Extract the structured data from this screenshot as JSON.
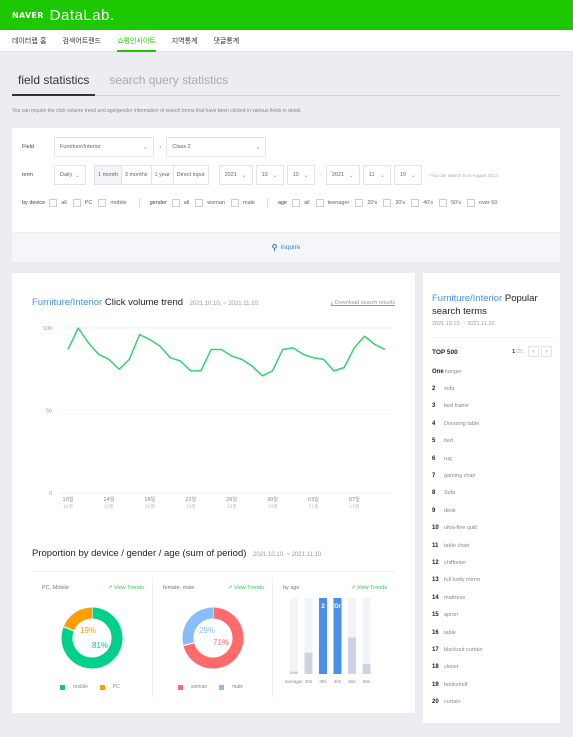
{
  "header": {
    "brand": "NAVER",
    "product": "DataLab."
  },
  "nav": {
    "items": [
      {
        "label": "데이터랩 홈",
        "active": false
      },
      {
        "label": "검색어트렌드",
        "active": false
      },
      {
        "label": "쇼핑인사이트",
        "active": true
      },
      {
        "label": "지역통계",
        "active": false
      },
      {
        "label": "댓글통계",
        "active": false
      }
    ]
  },
  "tabs": [
    {
      "label": "field statistics",
      "active": true
    },
    {
      "label": "search query statistics",
      "active": false
    }
  ],
  "description": "You can inquire the click volume trend and age/gender information of search terms that have been clicked in various fields in detail.",
  "filter": {
    "field_label": "Field",
    "field_select": "Furniture/Interior",
    "class_select": "Class 2",
    "term_label": "term",
    "interval_select": "Daily",
    "periods": [
      "1 month",
      "3 months",
      "1 year",
      "Direct input"
    ],
    "period_selected": "1 month",
    "start": {
      "year": "2021",
      "month": "10",
      "day": "10"
    },
    "end": {
      "year": "2021",
      "month": "11",
      "day": "10"
    },
    "range_sep": "~",
    "hint": "- You can search from August 2017.",
    "device_label": "by device",
    "device_options": [
      "all",
      "PC",
      "mobile"
    ],
    "gender_label": "gender",
    "gender_options": [
      "all",
      "woman",
      "male"
    ],
    "age_label": "age",
    "age_options": [
      "all",
      "teenager",
      "20's",
      "30's",
      "40's",
      "50's",
      "over 60"
    ],
    "inquire_label": "Inquire"
  },
  "trend": {
    "category": "Furniture/Interior",
    "title": "Click volume trend",
    "date_range": "2021.10.10. ~ 2021.11.10.",
    "download_label": "Download search results"
  },
  "chart_data": [
    {
      "type": "line",
      "title": "Furniture/Interior Click volume trend",
      "color": "#33d36b",
      "ylim": [
        0,
        100
      ],
      "yticks": [
        0,
        50,
        100
      ],
      "grid": true,
      "x": [
        "10/10",
        "10/11",
        "10/12",
        "10/13",
        "10/14",
        "10/15",
        "10/16",
        "10/17",
        "10/18",
        "10/19",
        "10/20",
        "10/21",
        "10/22",
        "10/23",
        "10/24",
        "10/25",
        "10/26",
        "10/27",
        "10/28",
        "10/29",
        "10/30",
        "10/31",
        "11/01",
        "11/02",
        "11/03",
        "11/04",
        "11/05",
        "11/06",
        "11/07",
        "11/08",
        "11/09",
        "11/10"
      ],
      "values": [
        87,
        100,
        91,
        84,
        81,
        75,
        81,
        96,
        93,
        89,
        82,
        80,
        74,
        74,
        87,
        87,
        83,
        81,
        77,
        71,
        74,
        87,
        88,
        84,
        82,
        81,
        74,
        76,
        88,
        95,
        90,
        87
      ],
      "xtick_labels": [
        {
          "day": "10일",
          "month": "10월"
        },
        {
          "day": "14일",
          "month": "10월"
        },
        {
          "day": "18일",
          "month": "10월"
        },
        {
          "day": "22일",
          "month": "10월"
        },
        {
          "day": "26일",
          "month": "10월"
        },
        {
          "day": "30일",
          "month": "10월"
        },
        {
          "day": "03일",
          "month": "11월"
        },
        {
          "day": "07일",
          "month": "11월"
        }
      ]
    },
    {
      "type": "pie",
      "title": "PC, Mobile",
      "slices": [
        {
          "label": "mobile",
          "value": 81,
          "color": "#00d08a"
        },
        {
          "label": "PC",
          "value": 19,
          "color": "#ff9e00"
        }
      ]
    },
    {
      "type": "pie",
      "title": "female, male",
      "slices": [
        {
          "label": "woman",
          "value": 71,
          "color": "#ff6b6b"
        },
        {
          "label": "male",
          "value": 29,
          "color": "#86bdfa"
        }
      ]
    },
    {
      "type": "bar",
      "title": "by age",
      "categories": [
        "teenager",
        "20's",
        "30's",
        "40's",
        "50's",
        "60's"
      ],
      "tick_labels": [
        "teenager",
        "20s",
        "30s",
        "40s",
        "50s",
        "60s"
      ],
      "values": [
        3,
        28,
        100,
        100,
        48,
        13
      ],
      "highlight": [
        false,
        false,
        true,
        true,
        false,
        false
      ],
      "value_labels": [
        "",
        "",
        "2",
        "Or",
        "",
        ""
      ],
      "ylim": [
        0,
        100
      ]
    }
  ],
  "proportion": {
    "title": "Proportion by device / gender / age (sum of period)",
    "date_range": "2021.10.10. ~ 2021.11.10.",
    "view_trends_label": "View Trends",
    "panels": [
      {
        "title": "PC, Mobile",
        "pct_a": "19%",
        "pct_b": "81%",
        "legend": [
          "mobile",
          "PC"
        ]
      },
      {
        "title": "female, male",
        "pct_a": "29%",
        "pct_b": "71%",
        "legend": [
          "woman",
          "male"
        ]
      },
      {
        "title": "by age"
      }
    ]
  },
  "popular": {
    "category": "Furniture/Interior",
    "title": "Popular search terms",
    "date_range": "2021.10.10. ~ 2021.11.10.",
    "top_label": "TOP 500",
    "page_current": "1",
    "page_total": "/25",
    "items": [
      {
        "rank": "One",
        "term": "hanger"
      },
      {
        "rank": "2",
        "term": "sofa"
      },
      {
        "rank": "3",
        "term": "bed frame"
      },
      {
        "rank": "4",
        "term": "Dressing table"
      },
      {
        "rank": "5",
        "term": "bed"
      },
      {
        "rank": "6",
        "term": "rug"
      },
      {
        "rank": "7",
        "term": "gaming chair"
      },
      {
        "rank": "8",
        "term": "Sofa"
      },
      {
        "rank": "9",
        "term": "desk"
      },
      {
        "rank": "10",
        "term": "ultra-fine quilt"
      },
      {
        "rank": "11",
        "term": "table chair"
      },
      {
        "rank": "12",
        "term": "chiffonier"
      },
      {
        "rank": "13",
        "term": "full body mirror"
      },
      {
        "rank": "14",
        "term": "mattress"
      },
      {
        "rank": "15",
        "term": "apron"
      },
      {
        "rank": "16",
        "term": "table"
      },
      {
        "rank": "17",
        "term": "blackout curtain"
      },
      {
        "rank": "18",
        "term": "closet"
      },
      {
        "rank": "19",
        "term": "bookshelf"
      },
      {
        "rank": "20",
        "term": "curtain"
      }
    ]
  }
}
